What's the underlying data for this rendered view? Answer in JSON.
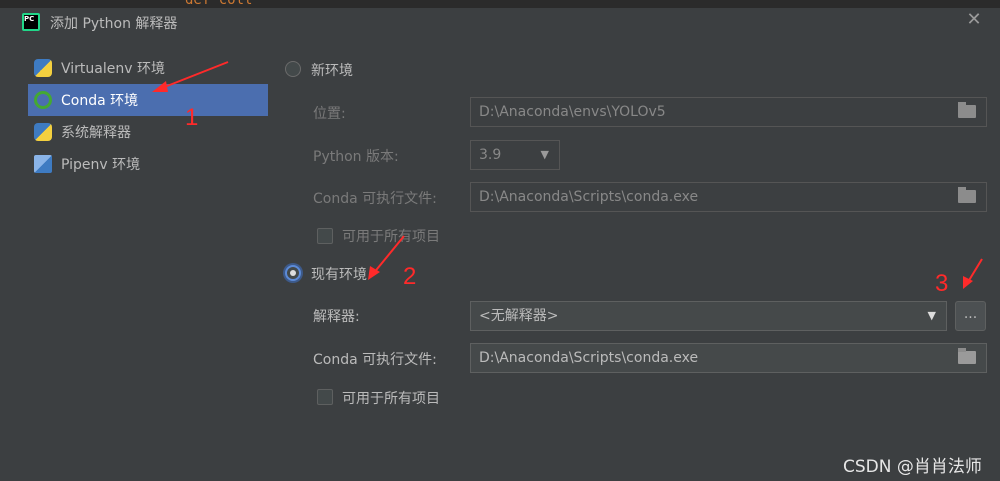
{
  "window": {
    "title": "添加 Python 解释器",
    "close_label": "✕"
  },
  "background_code": "def coll",
  "sidebar": {
    "items": [
      {
        "label": "Virtualenv 环境",
        "icon": "python-icon"
      },
      {
        "label": "Conda 环境",
        "icon": "conda-icon",
        "selected": true
      },
      {
        "label": "系统解释器",
        "icon": "python-icon"
      },
      {
        "label": "Pipenv 环境",
        "icon": "pipenv-icon"
      }
    ]
  },
  "new_env": {
    "radio_label": "新环境",
    "location_label": "位置:",
    "location_value": "D:\\Anaconda\\envs\\YOLOv5",
    "python_version_label": "Python 版本:",
    "python_version_value": "3.9",
    "conda_exe_label": "Conda 可执行文件:",
    "conda_exe_value": "D:\\Anaconda\\Scripts\\conda.exe",
    "all_projects_label": "可用于所有项目"
  },
  "existing_env": {
    "radio_label": "现有环境",
    "interpreter_label": "解释器:",
    "interpreter_value": "<无解释器>",
    "browse_label": "...",
    "conda_exe_label": "Conda 可执行文件:",
    "conda_exe_value": "D:\\Anaconda\\Scripts\\conda.exe",
    "all_projects_label": "可用于所有项目"
  },
  "annotations": [
    "1",
    "2",
    "3"
  ],
  "annotation_color": "#ff2a2a",
  "watermark": "CSDN @肖肖法师"
}
